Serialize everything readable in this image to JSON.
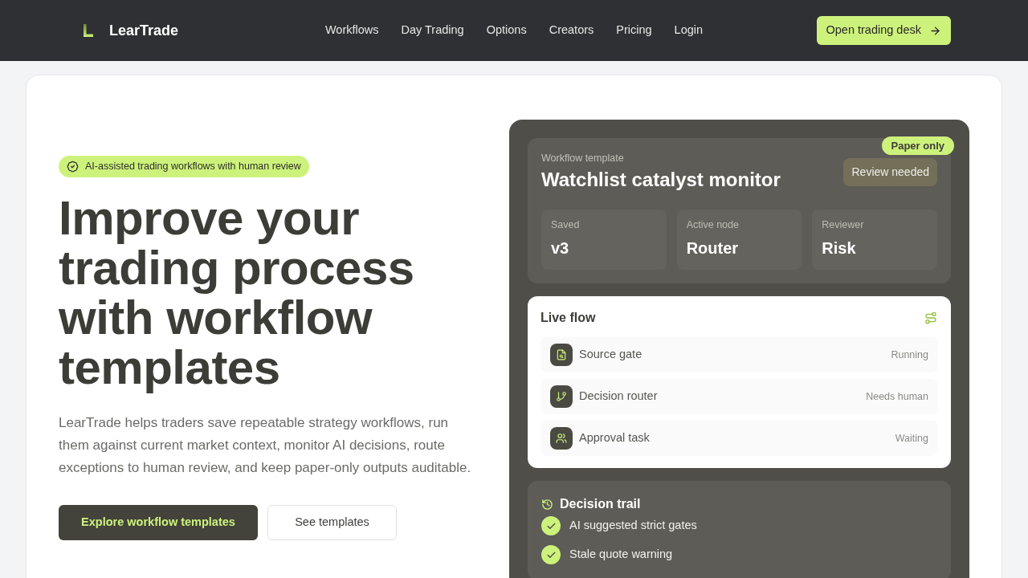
{
  "header": {
    "logo": "LearTrade",
    "nav": [
      "Workflows",
      "Day Trading",
      "Options",
      "Creators",
      "Pricing",
      "Login"
    ],
    "cta": "Open trading desk"
  },
  "hero": {
    "badge": "AI-assisted trading workflows with human review",
    "heading": "Improve your trading process with workflow templates",
    "description": "LearTrade helps traders save repeatable strategy workflows, run them against current market context, monitor AI decisions, route exceptions to human review, and keep paper-only outputs auditable.",
    "buttons": [
      {
        "label": "Explore workflow templates",
        "kind": "primary"
      },
      {
        "label": "See templates",
        "kind": "secondary"
      }
    ]
  },
  "template_card": {
    "eyebrow": "Workflow template",
    "title": "Watchlist catalyst monitor",
    "tag": "Paper only",
    "status": "Review needed",
    "stats": [
      {
        "label": "Saved",
        "value": "v3"
      },
      {
        "label": "Active node",
        "value": "Router"
      },
      {
        "label": "Reviewer",
        "value": "Risk"
      }
    ]
  },
  "live_flow": {
    "title": "Live flow",
    "nodes": [
      {
        "kind": "source",
        "name": "Source gate",
        "status": "Running"
      },
      {
        "kind": "router",
        "name": "Decision router",
        "status": "Needs human"
      },
      {
        "kind": "approval",
        "name": "Approval task",
        "status": "Waiting"
      }
    ]
  },
  "decision_trail": {
    "title": "Decision trail",
    "items": [
      {
        "text": "AI suggested strict gates",
        "checked": true
      },
      {
        "text": "Stale quote warning",
        "checked": true
      }
    ]
  }
}
